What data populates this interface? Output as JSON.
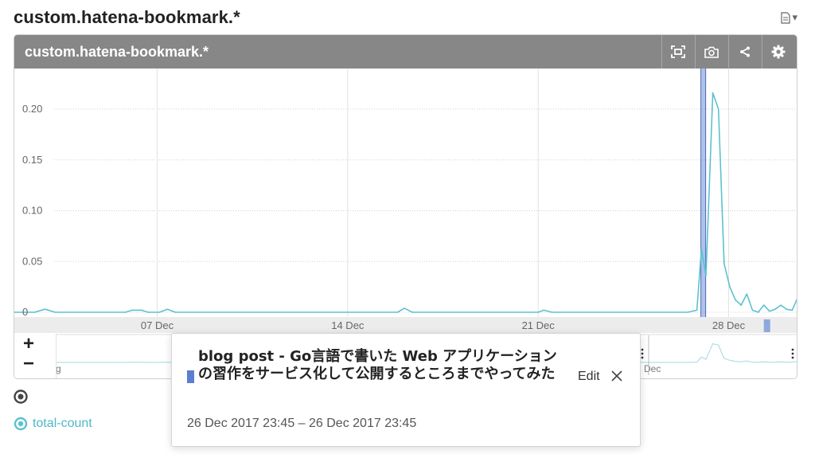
{
  "page": {
    "title": "custom.hatena-bookmark.*",
    "doc_menu_icon": "document-icon",
    "doc_menu_caret": "▾"
  },
  "panel": {
    "title": "custom.hatena-bookmark.*",
    "tools": [
      "fit-icon",
      "camera-icon",
      "share-icon",
      "gear-icon"
    ]
  },
  "zoom": {
    "in_label": "+",
    "out_label": "−"
  },
  "legend": {
    "series_name": "total-count",
    "series_color": "#5bc2cf"
  },
  "annotation": {
    "title": "blog post - Go言語で書いた Web アプリケーションの習作をサービス化して公開するところまでやってみた",
    "edit_label": "Edit",
    "time_range": "26 Dec 2017 23:45 – 26 Dec 2017 23:45",
    "marker_color": "#5b7fd0"
  },
  "chart_data": {
    "type": "line",
    "title": "",
    "xlabel": "",
    "ylabel": "",
    "x_range": [
      "2017-12-01 18:00",
      "2017-12-30 12:00"
    ],
    "ylim": [
      0,
      0.24
    ],
    "y_ticks": [
      0,
      0.05,
      0.1,
      0.15,
      0.2
    ],
    "y_tick_labels": [
      "0",
      "0.05",
      "0.10",
      "0.15",
      "0.20"
    ],
    "x_ticks": [
      "2017-12-07",
      "2017-12-14",
      "2017-12-21",
      "2017-12-28"
    ],
    "x_tick_labels": [
      "07 Dec",
      "14 Dec",
      "21 Dec",
      "28 Dec"
    ],
    "grid": true,
    "annotation_band": [
      "2017-12-26 23:30",
      "2017-12-27 00:00"
    ],
    "series": [
      {
        "name": "total-count",
        "color": "#5bc2cf",
        "points": [
          [
            "2017-12-01 18:00",
            0
          ],
          [
            "2017-12-02 12:00",
            0
          ],
          [
            "2017-12-02 21:00",
            0.003
          ],
          [
            "2017-12-03 06:00",
            0
          ],
          [
            "2017-12-05 20:00",
            0
          ],
          [
            "2017-12-06 02:00",
            0.002
          ],
          [
            "2017-12-06 10:00",
            0.002
          ],
          [
            "2017-12-06 16:00",
            0
          ],
          [
            "2017-12-07 02:00",
            0
          ],
          [
            "2017-12-07 09:00",
            0.003
          ],
          [
            "2017-12-07 16:00",
            0
          ],
          [
            "2017-12-15 20:00",
            0
          ],
          [
            "2017-12-16 02:00",
            0.004
          ],
          [
            "2017-12-16 09:00",
            0
          ],
          [
            "2017-12-21 00:00",
            0
          ],
          [
            "2017-12-21 05:00",
            0.002
          ],
          [
            "2017-12-21 12:00",
            0
          ],
          [
            "2017-12-26 12:00",
            0
          ],
          [
            "2017-12-26 20:00",
            0.002
          ],
          [
            "2017-12-27 00:00",
            0.062
          ],
          [
            "2017-12-27 04:00",
            0.036
          ],
          [
            "2017-12-27 10:00",
            0.216
          ],
          [
            "2017-12-27 15:00",
            0.2
          ],
          [
            "2017-12-27 20:00",
            0.048
          ],
          [
            "2017-12-28 01:00",
            0.025
          ],
          [
            "2017-12-28 06:00",
            0.012
          ],
          [
            "2017-12-28 11:00",
            0.007
          ],
          [
            "2017-12-28 16:00",
            0.018
          ],
          [
            "2017-12-28 21:00",
            0.002
          ],
          [
            "2017-12-29 02:00",
            0
          ],
          [
            "2017-12-29 07:00",
            0.007
          ],
          [
            "2017-12-29 12:00",
            0.001
          ],
          [
            "2017-12-29 17:00",
            0.003
          ],
          [
            "2017-12-29 22:00",
            0.007
          ],
          [
            "2017-12-30 03:00",
            0.003
          ],
          [
            "2017-12-30 08:00",
            0.002
          ],
          [
            "2017-12-30 12:00",
            0.012
          ],
          [
            "2017-12-30 15:00",
            0.007
          ],
          [
            "2017-12-30 18:00",
            0
          ]
        ]
      }
    ]
  },
  "navigator": {
    "start_label": "g",
    "end_label": "Dec"
  }
}
